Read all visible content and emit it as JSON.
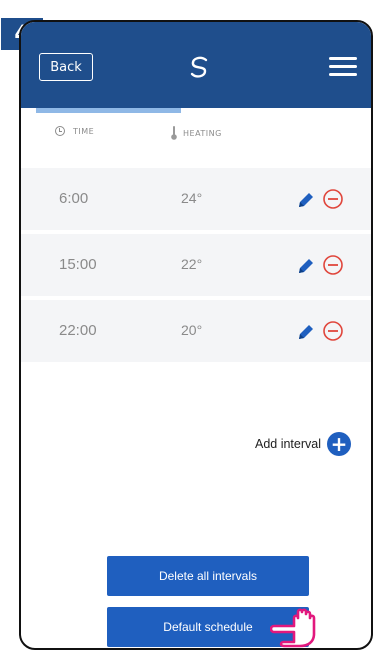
{
  "step": "4",
  "header": {
    "back_label": "Back"
  },
  "columns": {
    "time_label": "TIME",
    "heating_label": "HEATING"
  },
  "intervals": [
    {
      "time": "6:00",
      "temp": "24°"
    },
    {
      "time": "15:00",
      "temp": "22°"
    },
    {
      "time": "22:00",
      "temp": "20°"
    }
  ],
  "add_interval": {
    "label": "Add interval",
    "icon": "+"
  },
  "buttons": {
    "delete_all": "Delete all intervals",
    "default_schedule": "Default schedule"
  },
  "colors": {
    "brand": "#1f4e8c",
    "accent": "#1f5fbf",
    "remove": "#e0463c",
    "hand": "#e2187d"
  }
}
